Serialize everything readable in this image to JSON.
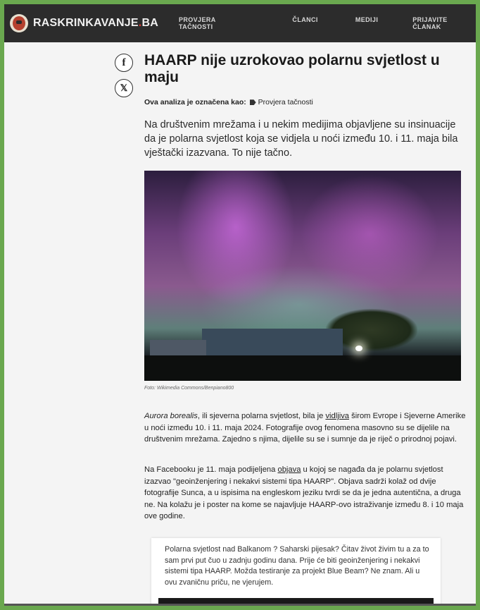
{
  "header": {
    "logo_text": "RASKRINKAVANJE",
    "logo_dot": ".",
    "logo_suffix": "BA",
    "nav": [
      "PROVJERA TAČNOSTI",
      "ČLANCI",
      "MEDIJI",
      "PRIJAVITE ČLANAK"
    ]
  },
  "social": {
    "facebook_glyph": "f",
    "x_glyph": "𝕏"
  },
  "article": {
    "title": "HAARP nije uzrokovao polarnu svjetlost u maju",
    "tag_label": "Ova analiza je označena kao:",
    "tag_value": "Provjera tačnosti",
    "lead": "Na društvenim mrežama i u nekim medijima objavljene su insinuacije da je polarna svjetlost koja se vidjela u noći između 10. i 11. maja bila vještački izazvana. To nije tačno.",
    "caption": "Foto: Wikimedia Commons/Benpiano800",
    "p1_em": "Aurora borealis",
    "p1_a": ", ili sjeverna polarna svjetlost, bila je ",
    "p1_link": "vidljiva",
    "p1_b": " širom Evrope i Sjeverne Amerike u noći između 10. i 11. maja 2024. Fotografije ovog fenomena masovno su se dijelile na društvenim mrežama. Zajedno s njima, dijelile su se i sumnje da je riječ o prirodnoj pojavi.",
    "p2_a": "Na Facebooku je 11. maja podijeljena ",
    "p2_link": "objava",
    "p2_b": " u kojoj se nagađa da je polarnu svjetlost izazvao \"geoinženjering i nekakvi sistemi tipa HAARP\". Objava sadrži kolaž od dvije fotografije Sunca, a u ispisima na engleskom jeziku tvrdi se da je jedna autentična, a druga ne. Na kolažu je i poster na kome se najavljuje HAARP-ovo istraživanje između 8. i 10 maja ove godine.",
    "quote": "Polarna svjetlost nad Balkanom ? Saharski pijesak? Čitav život živim tu a za to sam prvi put čuo u zadnju godinu dana. Prije će biti geoinženjering i nekakvi sistemi tipa HAARP. Možda testiranje za projekt Blue Beam? Ne znam. Ali u ovu zvaničnu priču, ne vjerujem."
  },
  "colors": {
    "page_border": "#6aa84f",
    "header_bg": "#2c2c2c",
    "logo_dot": "#e0332b"
  }
}
